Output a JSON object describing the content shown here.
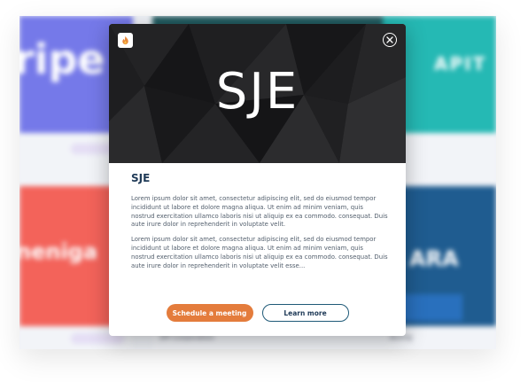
{
  "background": {
    "cards": [
      {
        "brand": "ripe",
        "color": "#6a6ee8"
      },
      {
        "brand": "",
        "color": "#0f4d52"
      },
      {
        "brand": "APIT",
        "color": "#13b3ae"
      },
      {
        "brand": "neniga",
        "color": "#f2564d"
      },
      {
        "brand": "ARA",
        "color": "#0d4f87"
      }
    ],
    "captions": [
      "SPI Corporation",
      "Acting"
    ]
  },
  "modal": {
    "hero_title": "SJE",
    "company_name": "SJE",
    "paragraphs": [
      "Lorem ipsum dolor sit amet, consectetur adipiscing elit, sed do eiusmod tempor incididunt ut labore et dolore magna aliqua. Ut enim ad minim veniam, quis nostrud exercitation ullamco laboris nisi ut aliquip ex ea commodo. consequat. Duis aute irure dolor in reprehenderit in voluptate velit.",
      "Lorem ipsum dolor sit amet, consectetur adipiscing elit, sed do eiusmod tempor incididunt ut labore et dolore magna aliqua. Ut enim ad minim veniam, quis nostrud exercitation ullamco laboris nisi ut aliquip ex ea commodo. consequat. Duis aute irure dolor in reprehenderit in voluptate velit esse..."
    ],
    "primary_button": "Schedule a meeting",
    "secondary_button": "Learn more",
    "logo_icon": "flame-icon",
    "close_icon": "close-icon"
  },
  "colors": {
    "accent": "#e47c3c",
    "heading": "#1f3a57"
  }
}
